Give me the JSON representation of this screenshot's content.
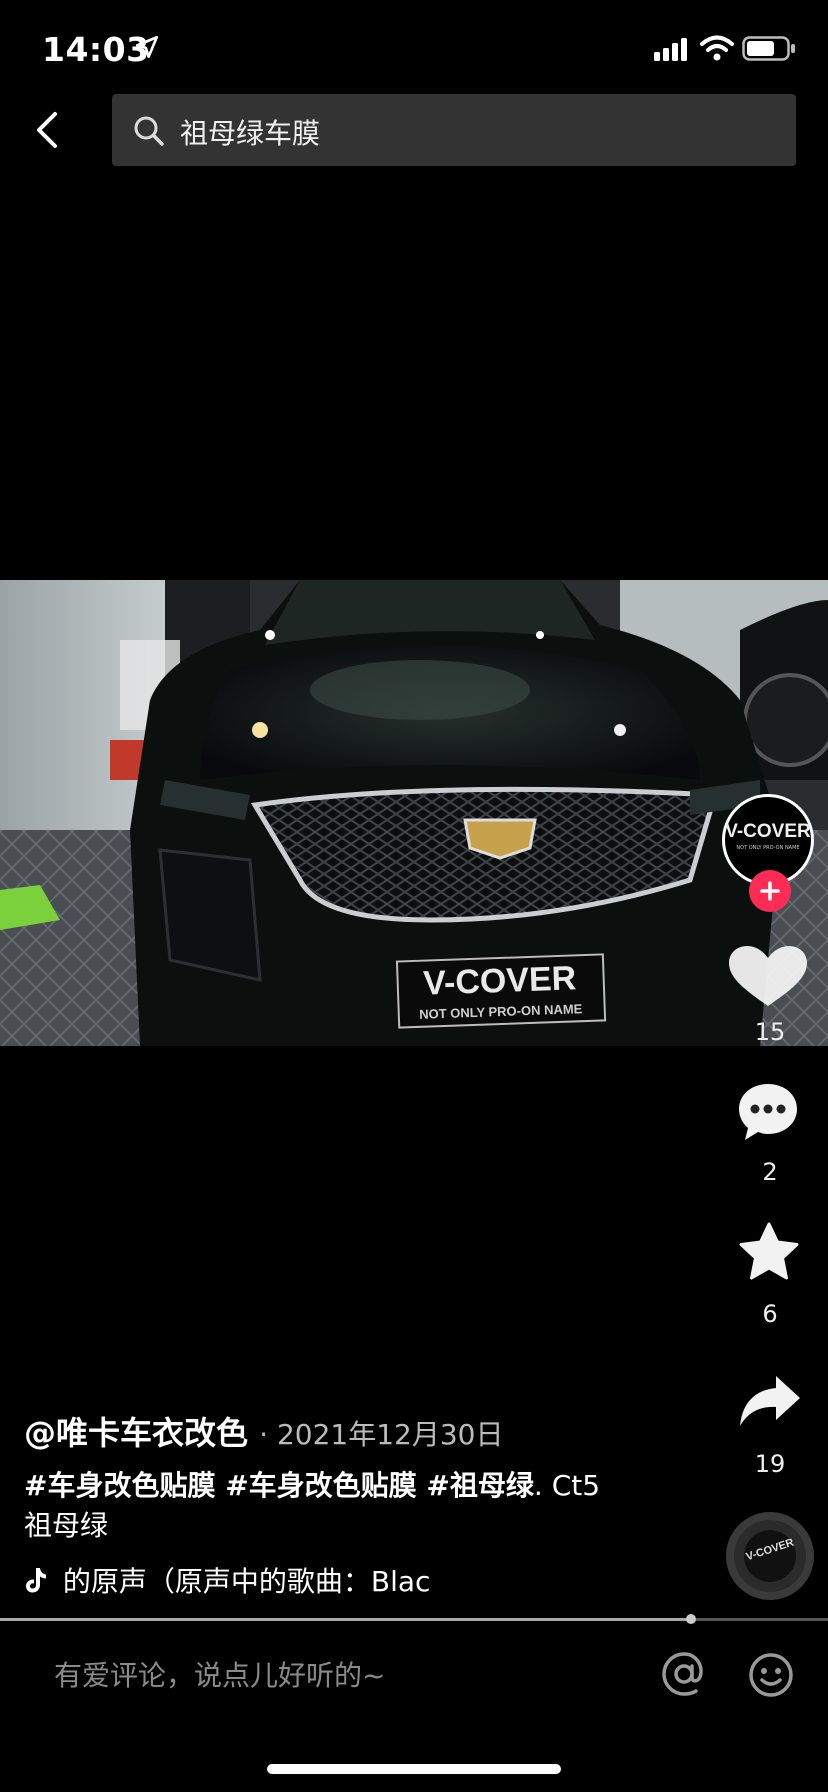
{
  "status_bar": {
    "time": "14:03"
  },
  "search": {
    "query": "祖母绿车膜"
  },
  "video": {
    "plate_brand": "V-COVER",
    "plate_tagline": "NOT ONLY PRO-ON NAME"
  },
  "rail": {
    "avatar_text": "V-COVER",
    "avatar_sub": "NOT ONLY PRO-ON NAME",
    "likes": "15",
    "comments": "2",
    "favorites": "6",
    "shares": "19",
    "disc_text": "V-COVER"
  },
  "post": {
    "author": "@唯卡车衣改色",
    "date": "· 2021年12月30日",
    "caption_tags": "#车身改色贴膜 #车身改色贴膜 #祖母绿",
    "caption_rest": ". Ct5 祖母绿",
    "music": "的原声（原声中的歌曲：Blac"
  },
  "progress": {
    "fraction": 0.835
  },
  "comment_bar": {
    "placeholder": "有爱评论，说点儿好听的~"
  },
  "colors": {
    "accent_red": "#fe2c55",
    "search_bg": "#333333"
  }
}
